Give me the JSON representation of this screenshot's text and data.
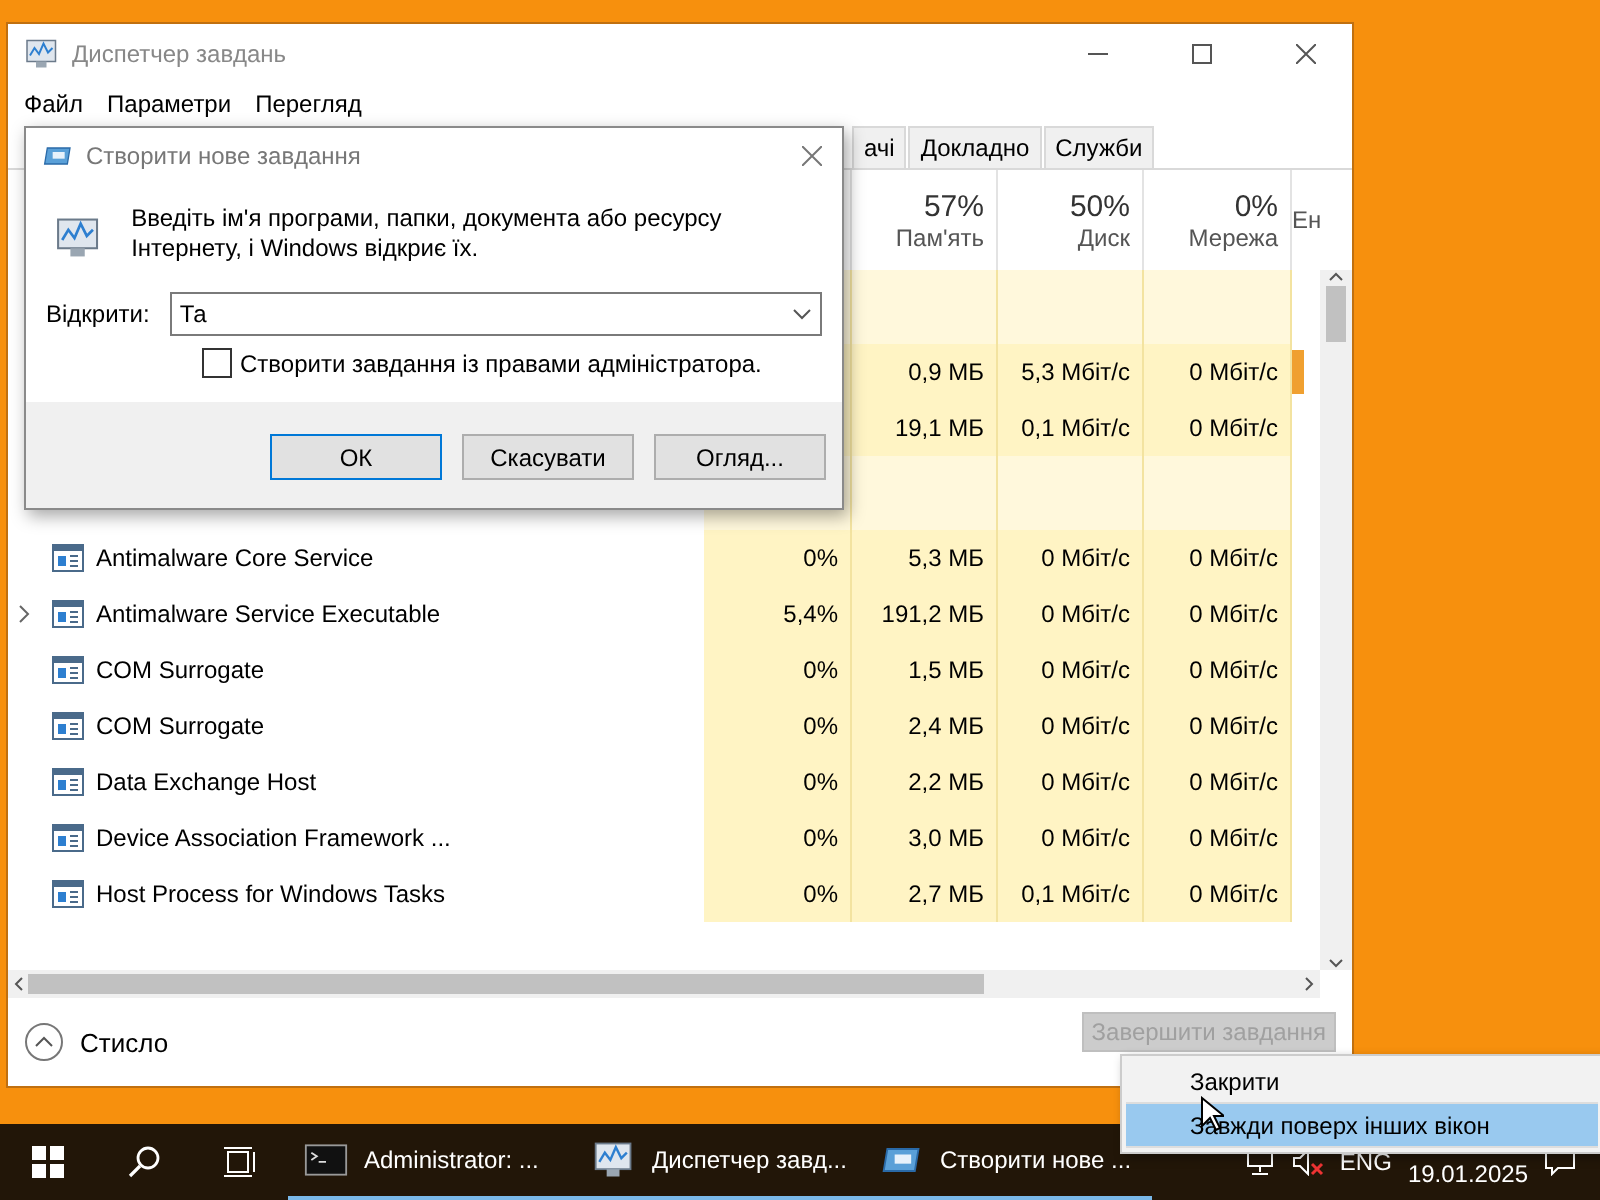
{
  "window": {
    "title": "Диспетчер завдань"
  },
  "menu": [
    "Файл",
    "Параметри",
    "Перегляд"
  ],
  "tabs": [
    {
      "label": "ачі",
      "selected": false
    },
    {
      "label": "Докладно",
      "selected": false
    },
    {
      "label": "Служби",
      "selected": false
    }
  ],
  "columns": [
    {
      "percent": "57%",
      "label": "Пам'ять"
    },
    {
      "percent": "50%",
      "label": "Диск"
    },
    {
      "percent": "0%",
      "label": "Мережа"
    }
  ],
  "column_6": {
    "label": "Ен"
  },
  "rows": [
    {
      "kind": "group"
    },
    {
      "kind": "process",
      "memory": "0,9 МБ",
      "disk": "5,3 Мбіт/с",
      "network": "0 Мбіт/с",
      "energy_high": true
    },
    {
      "kind": "process",
      "memory": "19,1 МБ",
      "disk": "0,1 Мбіт/с",
      "network": "0 Мбіт/с",
      "energy_high": false
    },
    {
      "kind": "group"
    },
    {
      "kind": "process",
      "name": "Antimalware Core Service",
      "expandable": false,
      "cpu": "0%",
      "memory": "5,3 МБ",
      "disk": "0 Мбіт/с",
      "network": "0 Мбіт/с",
      "energy_high": false
    },
    {
      "kind": "process",
      "name": "Antimalware Service Executable",
      "expandable": true,
      "cpu": "5,4%",
      "memory": "191,2 МБ",
      "disk": "0 Мбіт/с",
      "network": "0 Мбіт/с",
      "energy_high": false
    },
    {
      "kind": "process",
      "name": "COM Surrogate",
      "expandable": false,
      "cpu": "0%",
      "memory": "1,5 МБ",
      "disk": "0 Мбіт/с",
      "network": "0 Мбіт/с",
      "energy_high": false
    },
    {
      "kind": "process",
      "name": "COM Surrogate",
      "expandable": false,
      "cpu": "0%",
      "memory": "2,4 МБ",
      "disk": "0 Мбіт/с",
      "network": "0 Мбіт/с",
      "energy_high": false
    },
    {
      "kind": "process",
      "name": "Data Exchange Host",
      "expandable": false,
      "cpu": "0%",
      "memory": "2,2 МБ",
      "disk": "0 Мбіт/с",
      "network": "0 Мбіт/с",
      "energy_high": false
    },
    {
      "kind": "process",
      "name": "Device Association Framework ...",
      "expandable": false,
      "cpu": "0%",
      "memory": "3,0 МБ",
      "disk": "0 Мбіт/с",
      "network": "0 Мбіт/с",
      "energy_high": false
    },
    {
      "kind": "process",
      "name": "Host Process for Windows Tasks",
      "expandable": false,
      "cpu": "0%",
      "memory": "2,7 МБ",
      "disk": "0,1 Мбіт/с",
      "network": "0 Мбіт/с",
      "energy_high": false
    }
  ],
  "footer": {
    "toggle": "Стисло",
    "end_task": {
      "label": "Завершити завдання",
      "disabled": true
    }
  },
  "dialog": {
    "title": "Створити нове завдання",
    "message": "Введіть ім'я програми, папки, документа або ресурсу Інтернету, і Windows відкриє їх.",
    "open_label": "Відкрити:",
    "open_value": "Та",
    "admin": {
      "label": "Створити завдання із правами адміністратора.",
      "checked": false
    },
    "buttons": [
      "ОК",
      "Скасувати",
      "Огляд..."
    ]
  },
  "context_menu": [
    {
      "label": "Закрити",
      "selected": false
    },
    {
      "label": "Завжди поверх інших вікон",
      "selected": true
    }
  ],
  "taskbar": {
    "apps": [
      {
        "kind": "console",
        "label": "Administrator: ..."
      },
      {
        "kind": "monitor",
        "label": "Диспетчер завд..."
      },
      {
        "kind": "run",
        "label": "Створити нове ..."
      }
    ],
    "language": "ENG",
    "date": "19.01.2025"
  }
}
